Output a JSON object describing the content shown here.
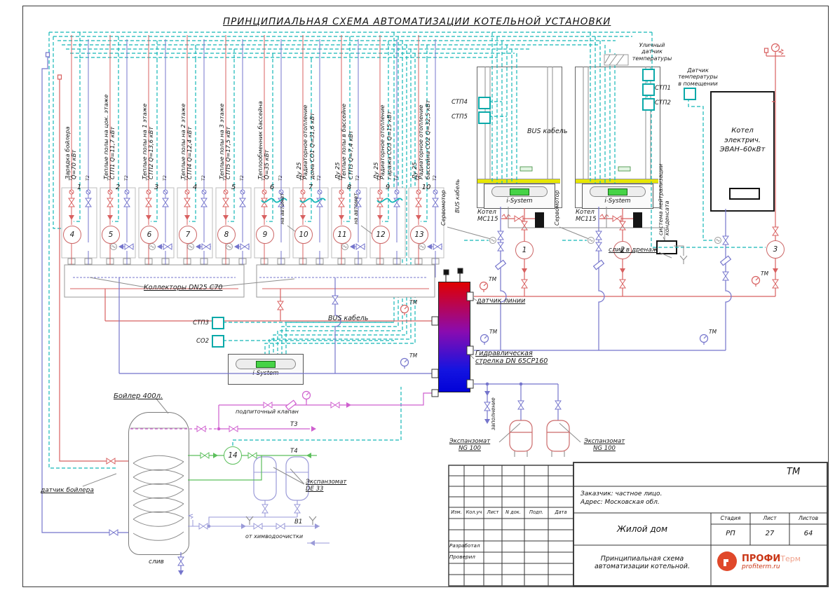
{
  "title": "ПРИНЦИПИАЛЬНАЯ СХЕМА АВТОМАТИЗАЦИИ КОТЕЛЬНОЙ УСТАНОВКИ",
  "labels": {
    "t1": "Т1",
    "t2": "Т2",
    "tm": "ТМ",
    "collectors": "Коллекторы DN25 С70",
    "bus_cable": "BUS кабель",
    "servo": "Сервомотор",
    "na_avtomat": "на автомат",
    "line_sensor": "датчик линии",
    "hydro_1": "Гидравлическая",
    "hydro_2": "стрелка DN 65CP160",
    "outdoor_1": "Уличный",
    "outdoor_2": "датчик",
    "outdoor_3": "температуры",
    "room_1": "Датчик",
    "room_2": "температуры",
    "room_3": "в помещении",
    "stp1": "СТП1",
    "stp2": "СТП2",
    "stp3": "СТП3",
    "stp4": "СТП4",
    "stp5": "СТП5",
    "co2": "СО2",
    "neutral_1": "система нейтрализации",
    "neutral_2": "конденсата",
    "drain_to": "слив в дренаж",
    "kotel_1": "Котел",
    "kotel_2": "MC115",
    "i_system": "i-System",
    "eboiler_1": "Котел",
    "eboiler_2": "электрич.",
    "eboiler_3": "ЭВАН–60кВт",
    "boiler400": "Бойлер 400л.",
    "makeup": "подпиточный клапан",
    "t3": "Т3",
    "t4": "Т4",
    "b1": "В1",
    "boiler_sensor": "датчик бойлера",
    "drain": "слив",
    "chem": "от химводоочистки",
    "fill": "заполнение",
    "exp_1": "Экспанзомат",
    "exp_de": "DE 33",
    "exp_ng": "NG 100"
  },
  "circuits": [
    {
      "num": "1",
      "lines": [
        "Зарядка бойлера",
        "Q=70 кВт"
      ]
    },
    {
      "num": "2",
      "lines": [
        "Теплые полы на цок. этаже",
        "СТП1 Q=11,7 кВт"
      ]
    },
    {
      "num": "3",
      "lines": [
        "Теплые полы на 1 этаже",
        "СТП2 Q=13,6 кВт"
      ]
    },
    {
      "num": "4",
      "lines": [
        "Теплые полы на 2 этаже",
        "СТП4 Q=12,4 кВт"
      ]
    },
    {
      "num": "5",
      "lines": [
        "Теплые полы на 3 этаже",
        "СТП5 Q=17,5 кВт"
      ]
    },
    {
      "num": "6",
      "lines": [
        "Теплообменник бассейна",
        "Q=35 кВт"
      ]
    },
    {
      "num": "7",
      "lines": [
        "Ду 25",
        "Радиаторное отопление",
        "дома СО1 Q=31,6 кВт"
      ]
    },
    {
      "num": "8",
      "lines": [
        "Ду 25",
        "Теплые полы в бассейне",
        "СТП3 Q=7,4 кВт"
      ]
    },
    {
      "num": "9",
      "lines": [
        "Ду 25",
        "Радиаторное отопление",
        "гаража СО3 Q=15 кВт"
      ]
    },
    {
      "num": "10",
      "lines": [
        "Ду 25",
        "Радиаторное отопление",
        "бассейна СО2 Q=32,5 кВт"
      ]
    }
  ],
  "pumps": [
    "1",
    "2",
    "3",
    "4",
    "5",
    "6",
    "7",
    "8",
    "9",
    "10",
    "11",
    "12",
    "13",
    "14"
  ],
  "titleblock": {
    "code": "ТМ",
    "customer": "Заказчик: частное лицо.",
    "address": "Адрес: Московская обл.",
    "cols": [
      "Изм.",
      "Кол.уч",
      "Лист",
      "N док.",
      "Подп.",
      "Дата"
    ],
    "developed": "Разработал",
    "checked": "Проверил",
    "object": "Жилой дом",
    "stage_h": "Стадия",
    "sheet_h": "Лист",
    "sheets_h": "Листов",
    "stage": "РП",
    "sheet": "27",
    "sheets": "64",
    "doc_1": "Принципиальная схема",
    "doc_2": "автоматизации котельной.",
    "logo_1": "ПРОФИ",
    "logo_2": "Терм",
    "logo_3": "profiterm.ru"
  }
}
